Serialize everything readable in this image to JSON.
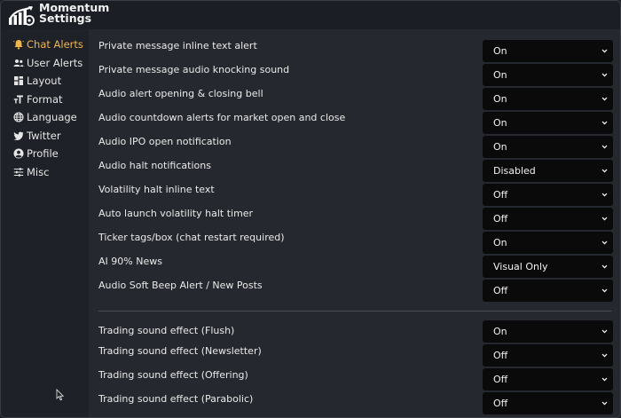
{
  "app": {
    "title_line1": "Momentum",
    "title_line2": "Settings"
  },
  "sidebar": {
    "items": [
      {
        "label": "Chat Alerts",
        "icon": "bell-icon",
        "active": true
      },
      {
        "label": "User Alerts",
        "icon": "users-icon",
        "active": false
      },
      {
        "label": "Layout",
        "icon": "layout-grid-icon",
        "active": false
      },
      {
        "label": "Format",
        "icon": "text-format-icon",
        "active": false
      },
      {
        "label": "Language",
        "icon": "globe-icon",
        "active": false
      },
      {
        "label": "Twitter",
        "icon": "twitter-icon",
        "active": false
      },
      {
        "label": "Profile",
        "icon": "user-circle-icon",
        "active": false
      },
      {
        "label": "Misc",
        "icon": "sliders-icon",
        "active": false
      }
    ]
  },
  "settings": [
    {
      "label": "Private message inline text alert",
      "value": "On"
    },
    {
      "label": "Private message audio knocking sound",
      "value": "On"
    },
    {
      "label": "Audio alert opening & closing bell",
      "value": "On"
    },
    {
      "label": "Audio countdown alerts for market open and close",
      "value": "On"
    },
    {
      "label": "Audio IPO open notification",
      "value": "On"
    },
    {
      "label": "Audio halt notifications",
      "value": "Disabled"
    },
    {
      "label": "Volatility halt inline text",
      "value": "Off"
    },
    {
      "label": "Auto launch volatility halt timer",
      "value": "Off"
    },
    {
      "label": "Ticker tags/box (chat restart required)",
      "value": "On"
    },
    {
      "label": "AI 90% News",
      "value": "Visual Only"
    },
    {
      "label": "Audio Soft Beep Alert / New Posts",
      "value": "Off"
    }
  ],
  "sound_settings": [
    {
      "label": "Trading sound effect (Flush)",
      "value": "On"
    },
    {
      "label": "Trading sound effect (Newsletter)",
      "value": "Off"
    },
    {
      "label": "Trading sound effect (Offering)",
      "value": "Off"
    },
    {
      "label": "Trading sound effect (Parabolic)",
      "value": "Off"
    }
  ],
  "colors": {
    "accent": "#f0b64a",
    "sidebar_bg": "#1e2127",
    "main_bg": "#25282e",
    "select_bg": "#0a0a0a"
  }
}
